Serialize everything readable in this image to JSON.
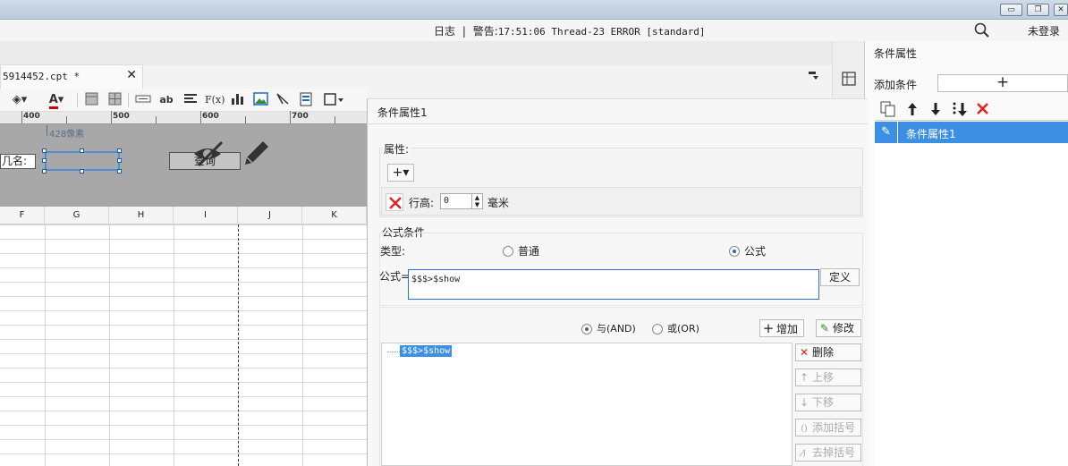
{
  "window": {
    "buttons": [
      {
        "name": "minimize",
        "glyph": "▭"
      },
      {
        "name": "restore",
        "glyph": "❐"
      },
      {
        "name": "close",
        "glyph": "✕"
      }
    ]
  },
  "status": {
    "log_label": "日志",
    "sep": "|",
    "warn_label": "警告:",
    "message": "17:51:06 Thread-23 ERROR [standard]",
    "login": "未登录"
  },
  "editor": {
    "file_tab": "5914452.cpt *",
    "file_tab_close": "✕",
    "ruler": [
      "400",
      "500",
      "600",
      "700"
    ],
    "px_label": "428像素",
    "name_label": "几名:",
    "query_button": "查询",
    "columns": [
      "F",
      "G",
      "H",
      "I",
      "J",
      "K"
    ]
  },
  "sidebar": {
    "title": "条件属性",
    "add_label": "添加条件",
    "add_button": "+",
    "item": "条件属性1"
  },
  "dialog": {
    "title": "条件属性1",
    "property_group": "属性:",
    "add_prop": "+▾",
    "row_height_label": "行高:",
    "row_height_value": "0",
    "row_height_unit": "毫米",
    "formula_group": "公式条件",
    "type_label": "类型:",
    "type_normal": "普通",
    "type_formula": "公式",
    "formula_label": "公式=",
    "formula_value": "$$$>$show",
    "define_button": "定义",
    "and_label": "与(AND)",
    "or_label": "或(OR)",
    "add_button": "增加",
    "modify_button": "修改",
    "conditions": [
      "$$$>$show"
    ],
    "delete_button": "删除",
    "up_button": "上移",
    "down_button": "下移",
    "add_bracket_button": "添加括号",
    "remove_bracket_button": "去掉括号"
  },
  "colors": {
    "accent": "#3d8fe3",
    "delete_red": "#e02020"
  }
}
